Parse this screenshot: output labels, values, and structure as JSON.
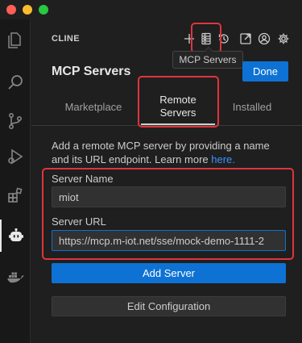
{
  "header": {
    "title": "CLINE",
    "icons": [
      "plus-icon",
      "mcp-servers-icon",
      "history-icon",
      "popout-icon",
      "account-icon",
      "settings-icon"
    ],
    "tooltip": "MCP Servers"
  },
  "page": {
    "title": "MCP Servers",
    "done_label": "Done"
  },
  "tabs": [
    {
      "label": "Marketplace",
      "active": false
    },
    {
      "label": "Remote Servers",
      "active": true
    },
    {
      "label": "Installed",
      "active": false
    }
  ],
  "form": {
    "description": "Add a remote MCP server by providing a name and its URL endpoint. Learn more",
    "learn_more_link": "here.",
    "server_name_label": "Server Name",
    "server_name_value": "miot",
    "server_url_label": "Server URL",
    "server_url_value": "https://mcp.m-iot.net/sse/mock-demo-1111-2",
    "add_button": "Add Server",
    "edit_button": "Edit Configuration"
  },
  "activity_bar": [
    "explorer-icon",
    "search-icon",
    "source-control-icon",
    "run-debug-icon",
    "extensions-icon",
    "cline-icon",
    "docker-icon"
  ],
  "colors": {
    "accent": "#0e72d4",
    "highlight": "#e0343c",
    "link": "#3794ff"
  }
}
